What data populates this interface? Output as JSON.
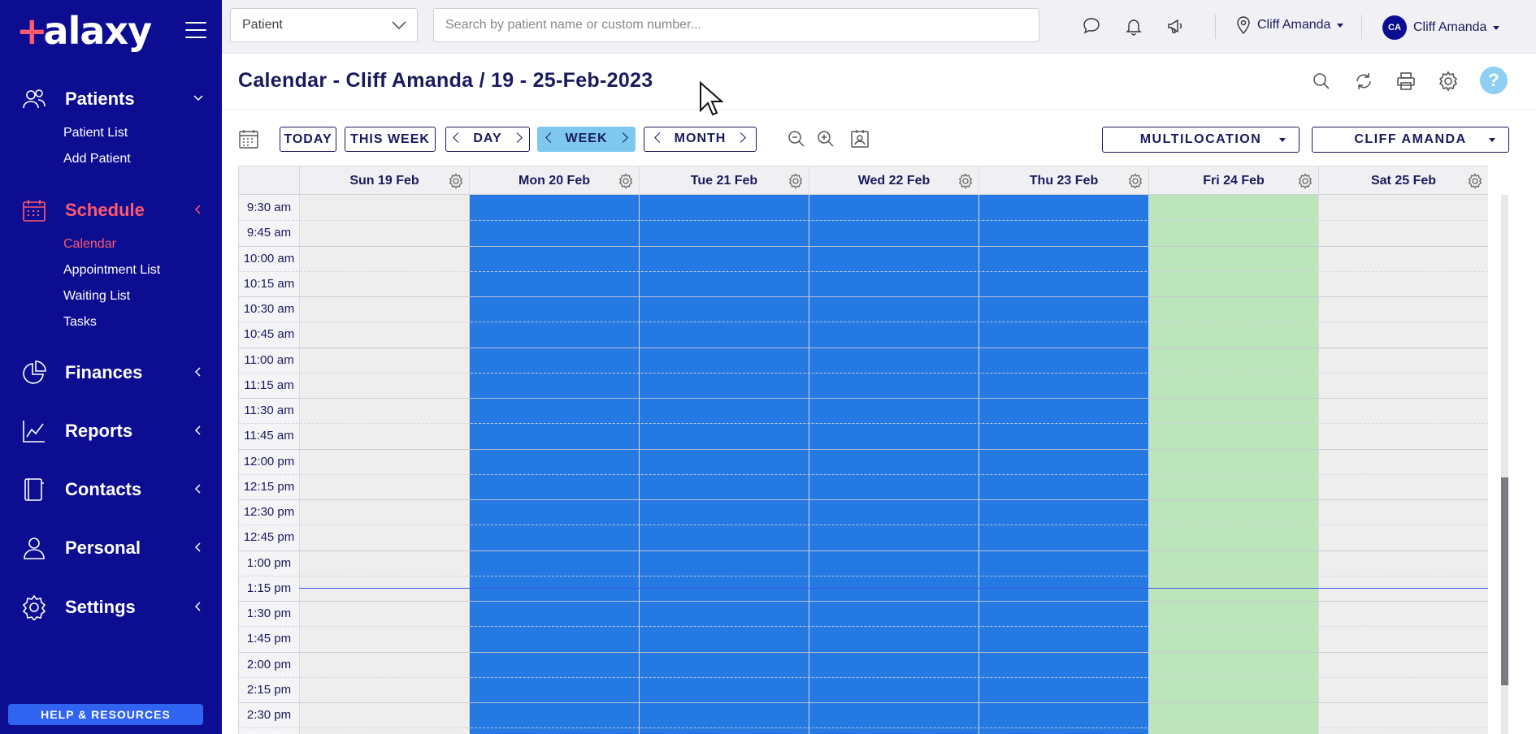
{
  "app": {
    "logo_text": "alaxy",
    "logo_plus": "+"
  },
  "sidebar": {
    "sections": [
      {
        "label": "Patients",
        "icon": "users-icon",
        "items": [
          "Patient List",
          "Add Patient"
        ]
      },
      {
        "label": "Schedule",
        "icon": "calendar-icon",
        "items": [
          "Calendar",
          "Appointment List",
          "Waiting List",
          "Tasks"
        ]
      },
      {
        "label": "Finances",
        "icon": "pie-chart-icon",
        "items": []
      },
      {
        "label": "Reports",
        "icon": "line-chart-icon",
        "items": []
      },
      {
        "label": "Contacts",
        "icon": "book-icon",
        "items": []
      },
      {
        "label": "Personal",
        "icon": "person-icon",
        "items": []
      },
      {
        "label": "Settings",
        "icon": "gear-icon",
        "items": []
      }
    ],
    "active_item": "Calendar",
    "help_label": "HELP & RESOURCES"
  },
  "topbar": {
    "patient_select": "Patient",
    "search_placeholder": "Search by patient name or custom number...",
    "location_label": "Cliff Amanda",
    "user_initials": "CA",
    "user_label": "Cliff Amanda"
  },
  "title": {
    "text": "Calendar - Cliff Amanda / 19 - 25-Feb-2023",
    "help_symbol": "?"
  },
  "toolbar": {
    "today": "TODAY",
    "this_week": "THIS WEEK",
    "day": "DAY",
    "week": "WEEK",
    "month": "MONTH",
    "multilocation": "MULTILOCATION",
    "practitioner": "CLIFF AMANDA"
  },
  "calendar": {
    "days": [
      {
        "label": "Sun 19 Feb",
        "color": "#eeeeee"
      },
      {
        "label": "Mon 20 Feb",
        "color": "#2479e2"
      },
      {
        "label": "Tue 21 Feb",
        "color": "#2479e2"
      },
      {
        "label": "Wed 22 Feb",
        "color": "#2479e2"
      },
      {
        "label": "Thu 23 Feb",
        "color": "#2479e2"
      },
      {
        "label": "Fri 24 Feb",
        "color": "#bde5bc"
      },
      {
        "label": "Sat 25 Feb",
        "color": "#eeeeee"
      }
    ],
    "times": [
      "9:30 am",
      "9:45 am",
      "10:00 am",
      "10:15 am",
      "10:30 am",
      "10:45 am",
      "11:00 am",
      "11:15 am",
      "11:30 am",
      "11:45 am",
      "12:00 pm",
      "12:15 pm",
      "12:30 pm",
      "12:45 pm",
      "1:00 pm",
      "1:15 pm",
      "1:30 pm",
      "1:45 pm",
      "2:00 pm",
      "2:15 pm",
      "2:30 pm"
    ]
  }
}
